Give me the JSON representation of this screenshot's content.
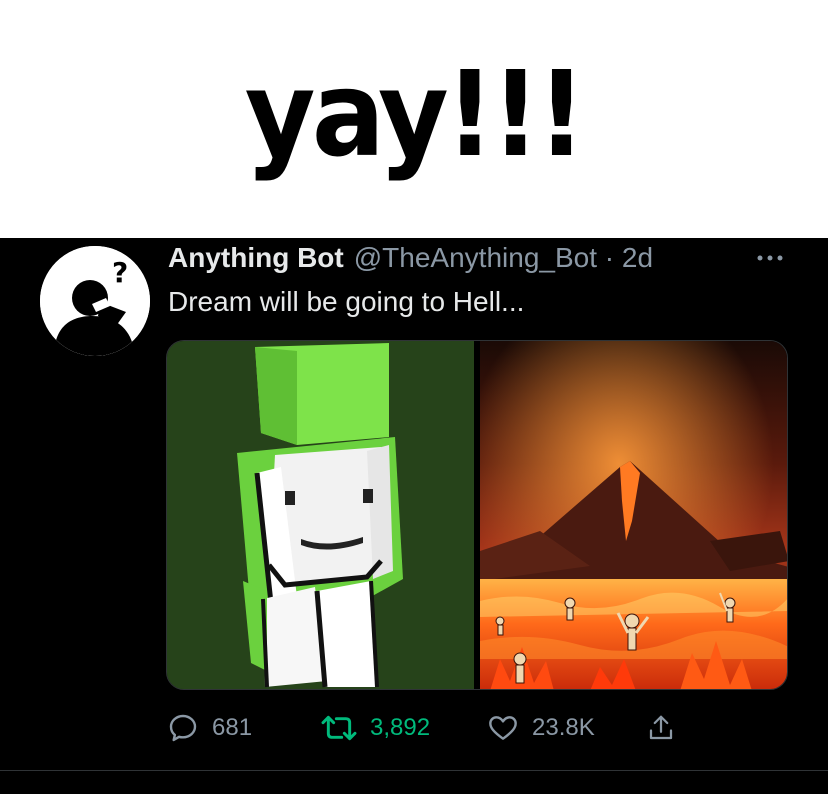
{
  "caption": {
    "text": "yay!!!"
  },
  "tweet": {
    "display_name": "Anything Bot",
    "handle_time": "@TheAnything_Bot · 2d",
    "more_icon": "ellipsis-icon",
    "text": "Dream will be going to Hell...",
    "avatar_icon": "question-head-icon",
    "media": [
      {
        "name": "dream-minecraft-skin",
        "description_icon": "minecraft-character-image"
      },
      {
        "name": "hell-volcano-image",
        "description_icon": "hell-landscape-image"
      }
    ],
    "actions": {
      "reply": {
        "icon": "reply-icon",
        "count": "681"
      },
      "retweet": {
        "icon": "retweet-icon",
        "count": "3,892"
      },
      "like": {
        "icon": "heart-icon",
        "count": "23.8K"
      },
      "share": {
        "icon": "share-icon"
      }
    }
  },
  "colors": {
    "background": "#000000",
    "text": "#e7e9ea",
    "muted": "#8b98a5",
    "retweet_green": "#00ba7c"
  }
}
